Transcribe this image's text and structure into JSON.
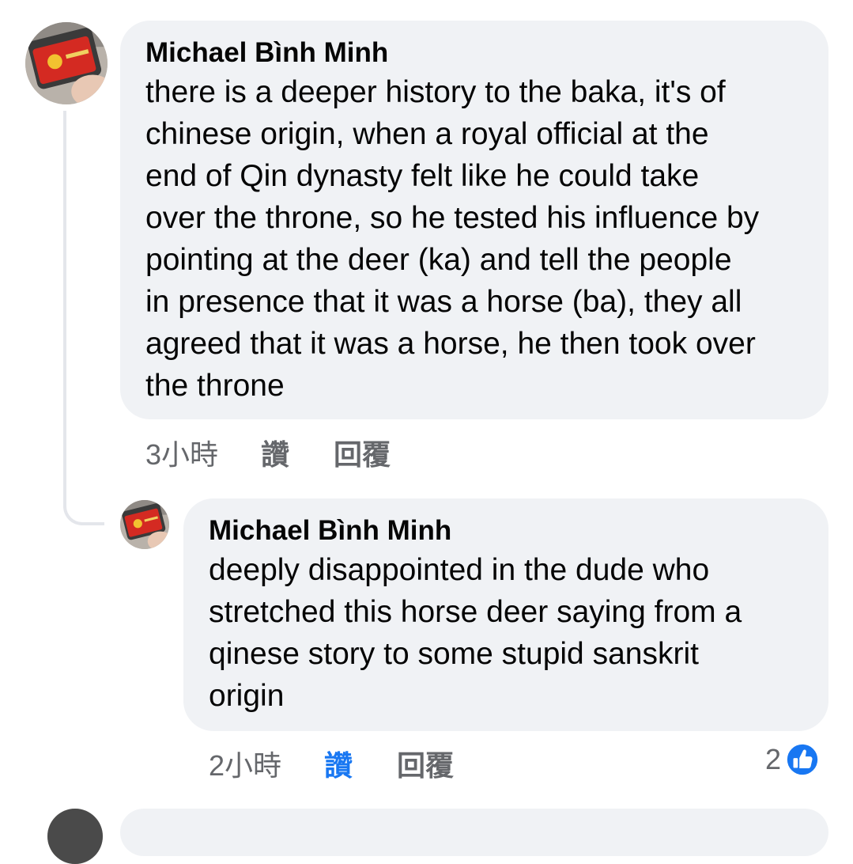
{
  "comment": {
    "author": "Michael Bình Minh",
    "text": "there is a deeper history to the baka, it's of\nchinese origin, when a royal official at the\nend of Qin dynasty felt like he could take\nover the throne, so he tested his influence by\npointing at the deer (ka) and tell the people\nin presence that it was a horse (ba), they all\nagreed that it was a horse, he then took over\nthe throne",
    "time": "3小時",
    "like_label": "讚",
    "reply_label": "回覆"
  },
  "reply": {
    "author": "Michael Bình Minh",
    "text": "deeply disappointed in the dude who\nstretched this horse deer saying from a\nqinese story to some stupid sanskrit\norigin",
    "time": "2小時",
    "like_label": "讚",
    "reply_label": "回覆",
    "liked": true,
    "reaction_count": "2",
    "reaction_icon": "thumbs-up-icon"
  },
  "colors": {
    "bubble": "#f0f2f5",
    "meta_text": "#65676b",
    "accent": "#1877f2",
    "thread_line": "#e4e6eb"
  }
}
